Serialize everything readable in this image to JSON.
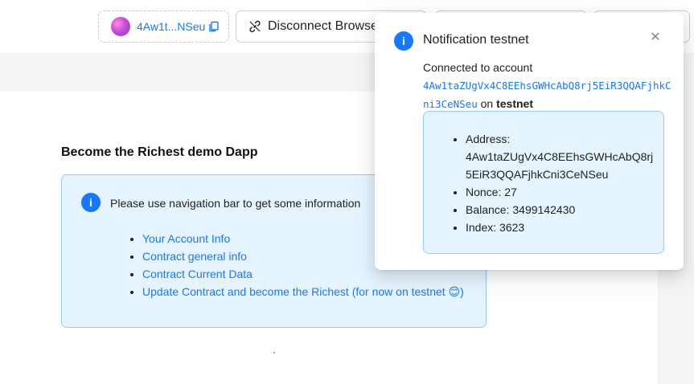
{
  "header": {
    "account_short": "4Aw1t...NSeu",
    "disconnect_label": "Disconnect Browser Wallet"
  },
  "main": {
    "title": "Become the Richest demo Dapp",
    "info_message": "Please use navigation bar to get some information",
    "links": [
      {
        "label": "Your Account Info"
      },
      {
        "label": "Contract general info"
      },
      {
        "label": "Contract Current Data"
      },
      {
        "label": "Update Contract and become the Richest (for now on testnet 😊)"
      }
    ]
  },
  "notification": {
    "title": "Notification testnet",
    "connected_prefix": "Connected to account",
    "account_full": "4Aw1taZUgVx4C8EEhsGWHcAbQ8rj5EiR3QQAFjhkCni3CeNSeu",
    "on_text": "on",
    "network": "testnet",
    "details": {
      "address_label": "Address:",
      "address_value": "4Aw1taZUgVx4C8EEhsGWHcAbQ8rj5EiR3QQAFjhkCni3CeNSeu",
      "nonce": "Nonce: 27",
      "balance": "Balance: 3499142430",
      "index": "Index: 3623"
    }
  },
  "icons": {
    "info": "info-icon",
    "close": "close-icon",
    "copy": "copy-icon",
    "disconnect": "unlink-icon"
  },
  "colors": {
    "accent": "#1677ff",
    "info_bg": "#e6f4ff",
    "info_border": "#91caff"
  }
}
